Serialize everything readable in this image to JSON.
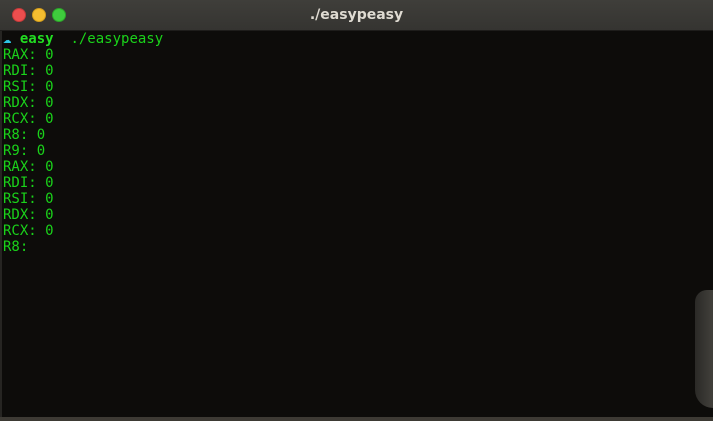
{
  "window": {
    "title": "./easypeasy",
    "controls": {
      "close": "close",
      "minimize": "minimize",
      "maximize": "maximize"
    },
    "colors": {
      "close": "#ed4e4e",
      "minimize": "#f5be30",
      "maximize": "#3fcb3d",
      "terminal_bg": "#0d0c0a",
      "text": "#1ad21a",
      "prompt_icon": "#2ec7e6"
    }
  },
  "terminal": {
    "prompt": {
      "icon": "☁",
      "icon_name": "cloud-icon",
      "directory": "easy",
      "command": "./easypeasy"
    },
    "lines": [
      "RAX: 0",
      "RDI: 0",
      "RSI: 0",
      "RDX: 0",
      "RCX: 0",
      "R8: 0",
      "R9: 0",
      "RAX: 0",
      "RDI: 0",
      "RSI: 0",
      "RDX: 0",
      "RCX: 0",
      "R8:"
    ]
  }
}
